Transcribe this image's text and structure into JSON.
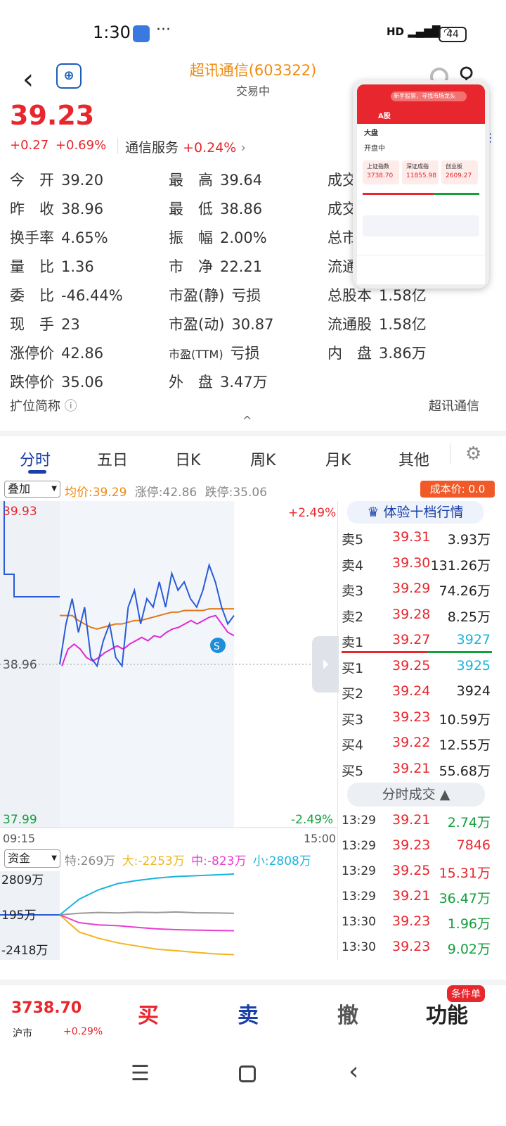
{
  "status_bar": {
    "time": "1:30",
    "dots": "···",
    "network": "HD",
    "battery": "44"
  },
  "header": {
    "stock_name": "超讯通信(603322)",
    "trade_status": "交易中"
  },
  "quote": {
    "price": "39.23",
    "change": "+0.27",
    "change_pct": "+0.69%",
    "sector_name": "通信服务",
    "sector_pct": "+0.24%",
    "sector_arrow": "›",
    "rows": [
      [
        {
          "k": "今　开",
          "v": "39.20"
        },
        {
          "k": "最　高",
          "v": "39.64"
        },
        {
          "k": "成交",
          "v": ""
        }
      ],
      [
        {
          "k": "昨　收",
          "v": "38.96"
        },
        {
          "k": "最　低",
          "v": "38.86"
        },
        {
          "k": "成交",
          "v": ""
        }
      ],
      [
        {
          "k": "换手率",
          "v": "4.65%"
        },
        {
          "k": "振　幅",
          "v": "2.00%"
        },
        {
          "k": "总市",
          "v": ""
        }
      ],
      [
        {
          "k": "量　比",
          "v": "1.36"
        },
        {
          "k": "市　净",
          "v": "22.21"
        },
        {
          "k": "流通",
          "v": ""
        }
      ],
      [
        {
          "k": "委　比",
          "v": "-46.44%"
        },
        {
          "k": "市盈(静)",
          "v": "亏损"
        },
        {
          "k": "总股本",
          "v": "1.58亿"
        }
      ],
      [
        {
          "k": "现　手",
          "v": "23"
        },
        {
          "k": "市盈(动)",
          "v": "30.87"
        },
        {
          "k": "流通股",
          "v": "1.58亿"
        }
      ],
      [
        {
          "k": "涨停价",
          "v": "42.86"
        },
        {
          "k": "市盈(TTM)",
          "v": "亏损"
        },
        {
          "k": "内　盘",
          "v": "3.86万"
        }
      ],
      [
        {
          "k": "跌停价",
          "v": "35.06"
        },
        {
          "k": "外　盘",
          "v": "3.47万"
        },
        {
          "k": "",
          "v": ""
        }
      ]
    ],
    "ext_label": "扩位简称",
    "ext_value": "超讯通信",
    "collapse": "^"
  },
  "mini_window": {
    "search_placeholder": "新手股票，寻找市场龙头",
    "tab": "A股",
    "sub_tab": "大盘",
    "status": "开盘中",
    "indices": [
      {
        "name": "上证指数",
        "value": "3738.70"
      },
      {
        "name": "深证成指",
        "value": "11855.98"
      },
      {
        "name": "创业板",
        "value": "2609.27"
      }
    ]
  },
  "tabs": [
    "分时",
    "五日",
    "日K",
    "周K",
    "月K",
    "其他"
  ],
  "chart_bar": {
    "overlay": "叠加",
    "avg_price": "均价:39.29",
    "limit_up": "涨停:42.86",
    "limit_down": "跌停:35.06",
    "cost": "成本价:  0.0"
  },
  "chart_data": {
    "type": "line",
    "y_high": "39.93",
    "y_mid": "38.96",
    "y_low": "37.99",
    "pct_high": "+2.49%",
    "pct_low": "-2.49%",
    "time_start": "09:15",
    "time_end": "15:00",
    "ylim": [
      37.99,
      39.93
    ],
    "price_series": [
      38.96,
      39.2,
      39.35,
      39.15,
      39.3,
      39.0,
      38.95,
      39.1,
      39.2,
      39.0,
      38.95,
      39.3,
      39.4,
      39.2,
      39.35,
      39.3,
      39.45,
      39.3,
      39.5,
      39.4,
      39.45,
      39.35,
      39.3,
      39.4,
      39.55,
      39.45,
      39.3,
      39.2,
      39.25
    ],
    "avg_series": [
      39.25,
      39.25,
      39.25,
      39.22,
      39.2,
      39.18,
      39.17,
      39.18,
      39.19,
      39.2,
      39.2,
      39.21,
      39.22,
      39.22,
      39.23,
      39.24,
      39.25,
      39.26,
      39.27,
      39.27,
      39.28,
      39.28,
      39.28,
      39.28,
      39.29,
      39.29,
      39.29,
      39.29,
      39.29
    ],
    "pink_series": [
      38.95,
      39.05,
      39.08,
      39.05,
      39.0,
      38.98,
      39.0,
      39.03,
      39.05,
      39.07,
      39.05,
      39.08,
      39.1,
      39.12,
      39.1,
      39.13,
      39.12,
      39.15,
      39.17,
      39.18,
      39.2,
      39.22,
      39.2,
      39.22,
      39.24,
      39.25,
      39.2,
      39.15,
      39.13
    ],
    "flow_ylabels": [
      "2809万",
      "195万",
      "-2418万"
    ],
    "flow_series": [
      {
        "name": "特",
        "values": [
          195,
          300,
          350,
          320,
          360,
          340,
          380,
          330,
          320,
          300
        ]
      },
      {
        "name": "大",
        "values": [
          195,
          -900,
          -1300,
          -1600,
          -1800,
          -2000,
          -2100,
          -2200,
          -2300,
          -2350
        ]
      },
      {
        "name": "中",
        "values": [
          195,
          -300,
          -450,
          -500,
          -600,
          -700,
          -750,
          -780,
          -800,
          -820
        ]
      },
      {
        "name": "小",
        "values": [
          195,
          1200,
          1800,
          2200,
          2400,
          2550,
          2650,
          2700,
          2750,
          2808
        ]
      }
    ]
  },
  "order_book": {
    "title": "体验十档行情",
    "asks": [
      {
        "l": "卖5",
        "p": "39.31",
        "q": "3.93万"
      },
      {
        "l": "卖4",
        "p": "39.30",
        "q": "131.26万"
      },
      {
        "l": "卖3",
        "p": "39.29",
        "q": "74.26万"
      },
      {
        "l": "卖2",
        "p": "39.28",
        "q": "8.25万"
      },
      {
        "l": "卖1",
        "p": "39.27",
        "q": "3927"
      }
    ],
    "bids": [
      {
        "l": "买1",
        "p": "39.25",
        "q": "3925"
      },
      {
        "l": "买2",
        "p": "39.24",
        "q": "3924"
      },
      {
        "l": "买3",
        "p": "39.23",
        "q": "10.59万"
      },
      {
        "l": "买4",
        "p": "39.22",
        "q": "12.55万"
      },
      {
        "l": "买5",
        "p": "39.21",
        "q": "55.68万"
      }
    ],
    "ticks_title": "分时成交 ▲",
    "ticks": [
      {
        "t": "13:29",
        "p": "39.21",
        "q": "2.74万",
        "c": "green"
      },
      {
        "t": "13:29",
        "p": "39.23",
        "q": "7846",
        "c": "red"
      },
      {
        "t": "13:29",
        "p": "39.25",
        "q": "15.31万",
        "c": "red"
      },
      {
        "t": "13:29",
        "p": "39.21",
        "q": "36.47万",
        "c": "green"
      },
      {
        "t": "13:30",
        "p": "39.23",
        "q": "1.96万",
        "c": "green"
      },
      {
        "t": "13:30",
        "p": "39.23",
        "q": "9.02万",
        "c": "green"
      }
    ]
  },
  "flow_bar": {
    "select": "资金",
    "te": "特:269万",
    "da": "大:-2253万",
    "zhong": "中:-823万",
    "xiao": "小:2808万"
  },
  "bottom": {
    "index_value": "3738.70",
    "index_name": "沪市",
    "index_change": "+0.29%",
    "buy": "买",
    "sell": "卖",
    "cancel": "撤",
    "func": "功能",
    "cond_badge": "条件单"
  },
  "colors": {
    "red": "#e8262d",
    "green": "#13a03c",
    "blue": "#1e8ed8",
    "navy": "#1a3fa8",
    "orange": "#f08a0c"
  }
}
